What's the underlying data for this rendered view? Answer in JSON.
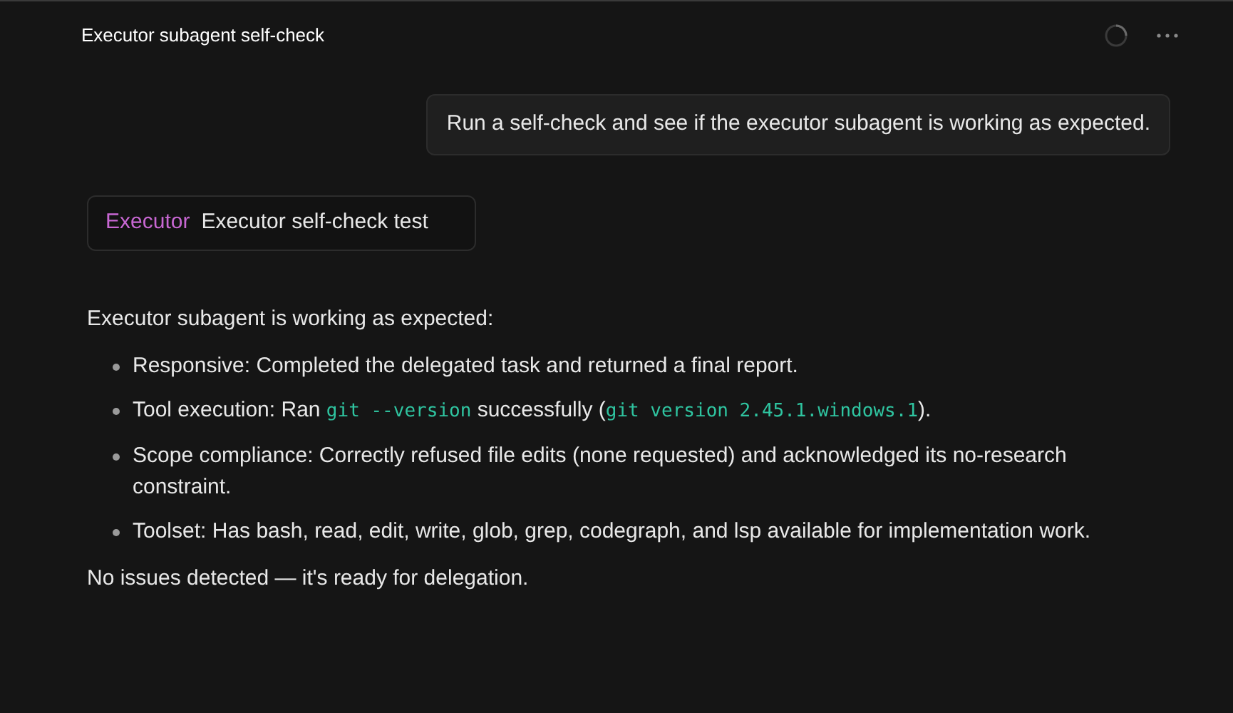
{
  "header": {
    "title": "Executor subagent self-check",
    "loading": true
  },
  "user_message": "Run a self-check and see if the executor subagent is working as expected.",
  "task_card": {
    "agent": "Executor",
    "description": "Executor self-check test"
  },
  "reply": {
    "intro": "Executor subagent is working as expected:",
    "bullets": [
      [
        {
          "kind": "text",
          "text": "Responsive: Completed the delegated task and returned a final report."
        }
      ],
      [
        {
          "kind": "text",
          "text": "Tool execution: Ran "
        },
        {
          "kind": "code",
          "text": "git --version"
        },
        {
          "kind": "text",
          "text": " successfully ("
        },
        {
          "kind": "code",
          "text": "git version 2.45.1.windows.1"
        },
        {
          "kind": "text",
          "text": ")."
        }
      ],
      [
        {
          "kind": "text",
          "text": "Scope compliance: Correctly refused file edits (none requested) and acknowledged its no-research constraint."
        }
      ],
      [
        {
          "kind": "text",
          "text": "Toolset: Has bash, read, edit, write, glob, grep, codegraph, and lsp available for implementation work."
        }
      ]
    ],
    "closing": "No issues detected — it's ready for delegation."
  }
}
